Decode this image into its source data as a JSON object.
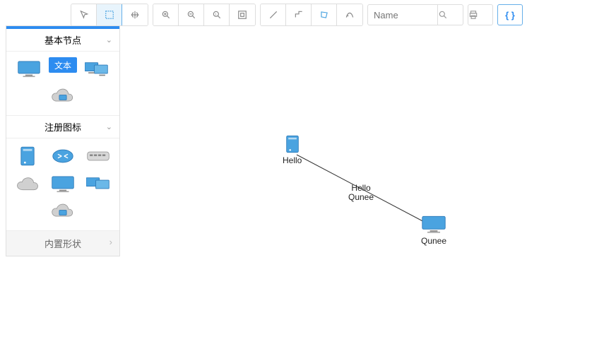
{
  "toolbar": {
    "search_placeholder": "Name"
  },
  "sidebar": {
    "section1": {
      "title": "基本节点",
      "text_chip": "文本"
    },
    "section2": {
      "title": "注册图标"
    },
    "section3": {
      "title": "内置形状"
    }
  },
  "canvas": {
    "node_hello_label": "Hello",
    "node_qunee_label": "Qunee",
    "edge_label_line1": "Hello",
    "edge_label_line2": "Qunee"
  },
  "icons": {
    "pointer": "pointer-icon",
    "marquee": "marquee-icon",
    "pan": "pan-icon",
    "zoom_in": "zoom-in-icon",
    "zoom_out": "zoom-out-icon",
    "zoom_reset": "zoom-reset-icon",
    "fit": "fit-screen-icon",
    "line": "line-icon",
    "polyline": "polyline-icon",
    "polygon": "polygon-icon",
    "curve": "curve-icon",
    "search": "search-icon",
    "print": "print-icon",
    "json": "json-icon"
  }
}
